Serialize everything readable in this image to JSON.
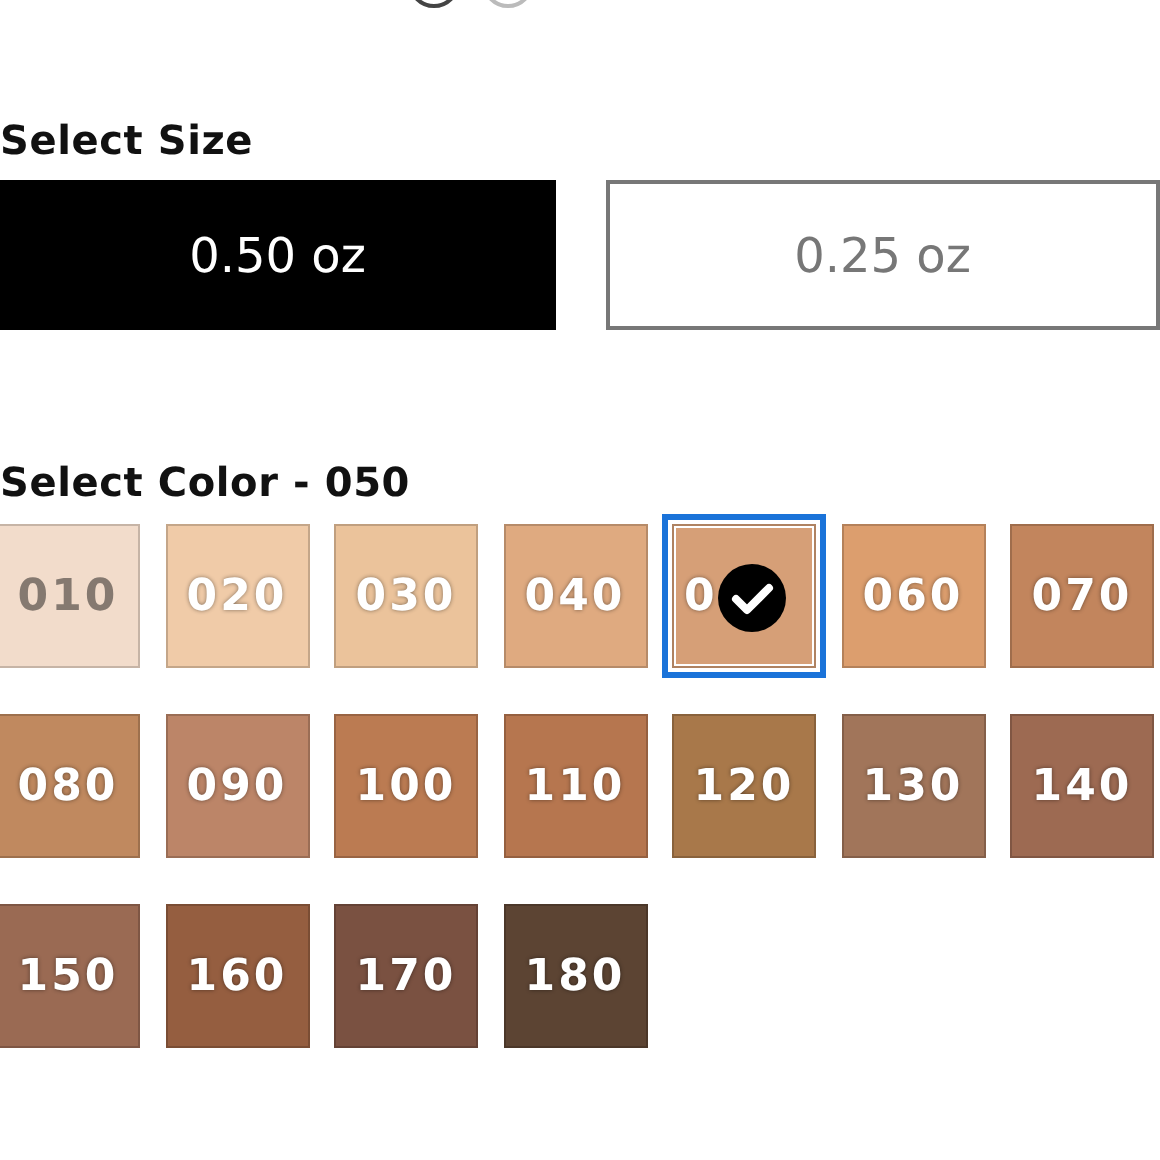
{
  "carousel_dots": [
    {
      "selected": true
    },
    {
      "selected": false
    }
  ],
  "size": {
    "heading": "Select Size",
    "options": [
      {
        "label": "0.50 oz",
        "selected": true
      },
      {
        "label": "0.25 oz",
        "selected": false
      }
    ]
  },
  "color": {
    "heading": "Select Color - 050",
    "swatches": [
      {
        "label": "010",
        "color": "#f2dccb",
        "selected": false
      },
      {
        "label": "020",
        "color": "#f0cba8",
        "selected": false
      },
      {
        "label": "030",
        "color": "#ebc39b",
        "selected": false
      },
      {
        "label": "040",
        "color": "#dfaa80",
        "selected": false
      },
      {
        "label": "0",
        "color": "#d69f77",
        "selected": true
      },
      {
        "label": "060",
        "color": "#dc9e6e",
        "selected": false
      },
      {
        "label": "070",
        "color": "#c2855d",
        "selected": false
      },
      {
        "label": "080",
        "color": "#c0895f",
        "selected": false
      },
      {
        "label": "090",
        "color": "#bc8568",
        "selected": false
      },
      {
        "label": "100",
        "color": "#bb7b52",
        "selected": false
      },
      {
        "label": "110",
        "color": "#b6764f",
        "selected": false
      },
      {
        "label": "120",
        "color": "#a8784a",
        "selected": false
      },
      {
        "label": "130",
        "color": "#a1755a",
        "selected": false
      },
      {
        "label": "140",
        "color": "#9d6a52",
        "selected": false
      },
      {
        "label": "150",
        "color": "#9a6a53",
        "selected": false
      },
      {
        "label": "160",
        "color": "#955e40",
        "selected": false
      },
      {
        "label": "170",
        "color": "#7a5141",
        "selected": false
      },
      {
        "label": "180",
        "color": "#5c4433",
        "selected": false
      }
    ]
  }
}
